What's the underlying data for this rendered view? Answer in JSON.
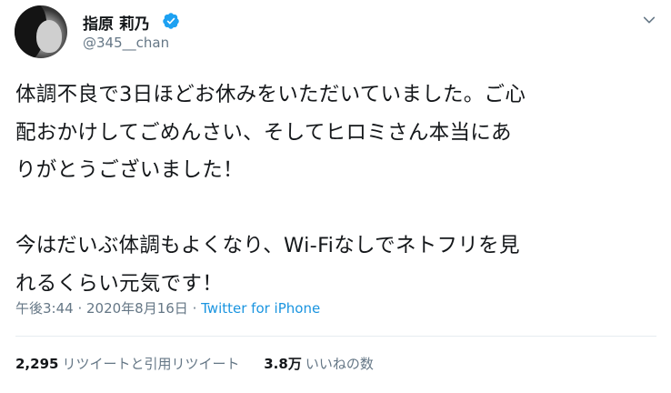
{
  "author": {
    "display_name": "指原 莉乃",
    "handle": "@345__chan",
    "verified": true
  },
  "tweet": {
    "lines_p1": [
      "体調不良で3日ほどお休みをいただいていました。ご心",
      "配おかけしてごめんさい、そしてヒロミさん本当にあ",
      "りがとうございました！"
    ],
    "lines_p2": [
      "今はだいぶ体調もよくなり、Wi-Fiなしでネトフリを見",
      "れるくらい元気です！"
    ]
  },
  "meta": {
    "time": "午後3:44",
    "separator1": " · ",
    "date": "2020年8月16日",
    "separator2": " · ",
    "source": "Twitter for iPhone"
  },
  "stats": {
    "retweets_count": "2,295",
    "retweets_label": "リツイートと引用リツイート",
    "likes_count": "3.8万",
    "likes_label": "いいねの数"
  },
  "icons": {
    "verified": "verified-badge-icon",
    "more": "chevron-down-icon"
  },
  "colors": {
    "link": "#1b95e0",
    "secondary_text": "#657786",
    "verified": "#1da1f2"
  }
}
